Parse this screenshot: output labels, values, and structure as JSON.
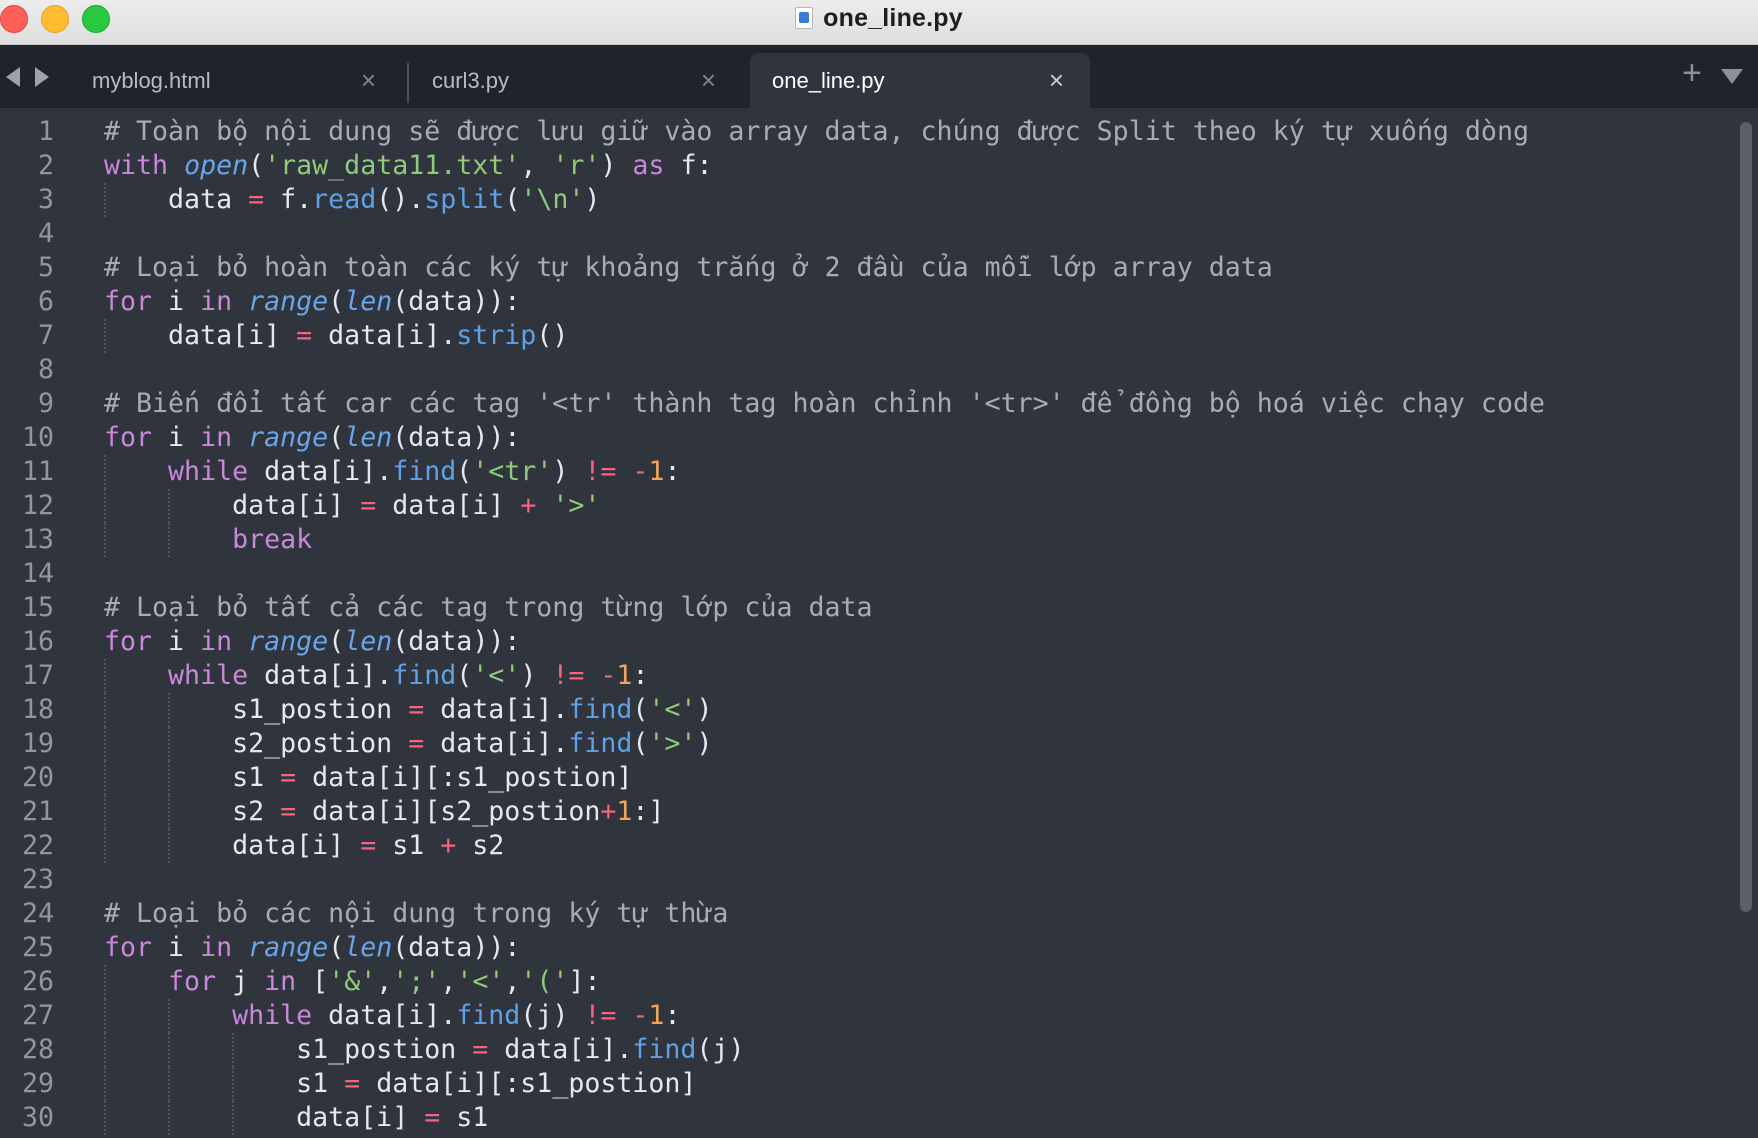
{
  "window": {
    "title": "one_line.py",
    "traffic_lights": [
      "close",
      "minimize",
      "maximize"
    ]
  },
  "tabs": [
    {
      "label": "myblog.html",
      "close": "×",
      "active": false
    },
    {
      "label": "curl3.py",
      "close": "×",
      "active": false
    },
    {
      "label": "one_line.py",
      "close": "×",
      "active": true
    }
  ],
  "tabbar": {
    "back_icon": "chevron-left-icon",
    "forward_icon": "chevron-right-icon",
    "new_tab": "+",
    "menu_icon": "chevron-down-icon"
  },
  "colors": {
    "background": "#2f343d",
    "comment": "#a7adb6",
    "keyword": "#c988d8",
    "builtin": "#6aa5e8",
    "string": "#8fca7d",
    "operator": "#f3667b",
    "number": "#f2a561"
  },
  "code_lines": [
    {
      "n": "1",
      "indent": 0,
      "tokens": [
        [
          "c",
          "# Toàn bộ nội dung sẽ được lưu giữ vào array data, chúng được Split theo ký tự xuống dòng"
        ]
      ]
    },
    {
      "n": "2",
      "indent": 0,
      "tokens": [
        [
          "k",
          "with "
        ],
        [
          "f",
          "open"
        ],
        [
          "p",
          "("
        ],
        [
          "s",
          "'raw_data11.txt'"
        ],
        [
          "p",
          ", "
        ],
        [
          "s",
          "'r'"
        ],
        [
          "p",
          ") "
        ],
        [
          "k",
          "as"
        ],
        [
          "p",
          " f:"
        ]
      ]
    },
    {
      "n": "3",
      "indent": 1,
      "tokens": [
        [
          "p",
          "    data "
        ],
        [
          "o",
          "="
        ],
        [
          "p",
          " f."
        ],
        [
          "m",
          "read"
        ],
        [
          "p",
          "()."
        ],
        [
          "m",
          "split"
        ],
        [
          "p",
          "("
        ],
        [
          "s",
          "'\\n'"
        ],
        [
          "p",
          ")"
        ]
      ]
    },
    {
      "n": "4",
      "indent": 0,
      "tokens": []
    },
    {
      "n": "5",
      "indent": 0,
      "tokens": [
        [
          "c",
          "# Loại bỏ hoàn toàn các ký tự khoảng trắng ở 2 đầu của mỗi lớp array data"
        ]
      ]
    },
    {
      "n": "6",
      "indent": 0,
      "tokens": [
        [
          "k",
          "for"
        ],
        [
          "p",
          " i "
        ],
        [
          "k",
          "in "
        ],
        [
          "f",
          "range"
        ],
        [
          "p",
          "("
        ],
        [
          "f",
          "len"
        ],
        [
          "p",
          "(data)):"
        ]
      ]
    },
    {
      "n": "7",
      "indent": 1,
      "tokens": [
        [
          "p",
          "    data[i] "
        ],
        [
          "o",
          "="
        ],
        [
          "p",
          " data[i]."
        ],
        [
          "m",
          "strip"
        ],
        [
          "p",
          "()"
        ]
      ]
    },
    {
      "n": "8",
      "indent": 0,
      "tokens": []
    },
    {
      "n": "9",
      "indent": 0,
      "tokens": [
        [
          "c",
          "# Biến đổi tất car các tag '<tr' thành tag hoàn chỉnh '<tr>' để đồng bộ hoá việc chạy code"
        ]
      ]
    },
    {
      "n": "10",
      "indent": 0,
      "tokens": [
        [
          "k",
          "for"
        ],
        [
          "p",
          " i "
        ],
        [
          "k",
          "in "
        ],
        [
          "f",
          "range"
        ],
        [
          "p",
          "("
        ],
        [
          "f",
          "len"
        ],
        [
          "p",
          "(data)):"
        ]
      ]
    },
    {
      "n": "11",
      "indent": 1,
      "tokens": [
        [
          "p",
          "    "
        ],
        [
          "k",
          "while"
        ],
        [
          "p",
          " data[i]."
        ],
        [
          "m",
          "find"
        ],
        [
          "p",
          "("
        ],
        [
          "s",
          "'<tr'"
        ],
        [
          "p",
          ") "
        ],
        [
          "o",
          "!="
        ],
        [
          "p",
          " "
        ],
        [
          "o",
          "-"
        ],
        [
          "n",
          "1"
        ],
        [
          "p",
          ":"
        ]
      ]
    },
    {
      "n": "12",
      "indent": 2,
      "tokens": [
        [
          "p",
          "        data[i] "
        ],
        [
          "o",
          "="
        ],
        [
          "p",
          " data[i] "
        ],
        [
          "o",
          "+"
        ],
        [
          "p",
          " "
        ],
        [
          "s",
          "'>'"
        ]
      ]
    },
    {
      "n": "13",
      "indent": 2,
      "tokens": [
        [
          "p",
          "        "
        ],
        [
          "k",
          "break"
        ]
      ]
    },
    {
      "n": "14",
      "indent": 0,
      "tokens": []
    },
    {
      "n": "15",
      "indent": 0,
      "tokens": [
        [
          "c",
          "# Loại bỏ tất cả các tag trong từng lớp của data"
        ]
      ]
    },
    {
      "n": "16",
      "indent": 0,
      "tokens": [
        [
          "k",
          "for"
        ],
        [
          "p",
          " i "
        ],
        [
          "k",
          "in "
        ],
        [
          "f",
          "range"
        ],
        [
          "p",
          "("
        ],
        [
          "f",
          "len"
        ],
        [
          "p",
          "(data)):"
        ]
      ]
    },
    {
      "n": "17",
      "indent": 1,
      "tokens": [
        [
          "p",
          "    "
        ],
        [
          "k",
          "while"
        ],
        [
          "p",
          " data[i]."
        ],
        [
          "m",
          "find"
        ],
        [
          "p",
          "("
        ],
        [
          "s",
          "'<'"
        ],
        [
          "p",
          ") "
        ],
        [
          "o",
          "!="
        ],
        [
          "p",
          " "
        ],
        [
          "o",
          "-"
        ],
        [
          "n",
          "1"
        ],
        [
          "p",
          ":"
        ]
      ]
    },
    {
      "n": "18",
      "indent": 2,
      "tokens": [
        [
          "p",
          "        s1_postion "
        ],
        [
          "o",
          "="
        ],
        [
          "p",
          " data[i]."
        ],
        [
          "m",
          "find"
        ],
        [
          "p",
          "("
        ],
        [
          "s",
          "'<'"
        ],
        [
          "p",
          ")"
        ]
      ]
    },
    {
      "n": "19",
      "indent": 2,
      "tokens": [
        [
          "p",
          "        s2_postion "
        ],
        [
          "o",
          "="
        ],
        [
          "p",
          " data[i]."
        ],
        [
          "m",
          "find"
        ],
        [
          "p",
          "("
        ],
        [
          "s",
          "'>'"
        ],
        [
          "p",
          ")"
        ]
      ]
    },
    {
      "n": "20",
      "indent": 2,
      "tokens": [
        [
          "p",
          "        s1 "
        ],
        [
          "o",
          "="
        ],
        [
          "p",
          " data[i][:s1_postion]"
        ]
      ]
    },
    {
      "n": "21",
      "indent": 2,
      "tokens": [
        [
          "p",
          "        s2 "
        ],
        [
          "o",
          "="
        ],
        [
          "p",
          " data[i][s2_postion"
        ],
        [
          "o",
          "+"
        ],
        [
          "n",
          "1"
        ],
        [
          "p",
          ":]"
        ]
      ]
    },
    {
      "n": "22",
      "indent": 2,
      "tokens": [
        [
          "p",
          "        data[i] "
        ],
        [
          "o",
          "="
        ],
        [
          "p",
          " s1 "
        ],
        [
          "o",
          "+"
        ],
        [
          "p",
          " s2"
        ]
      ]
    },
    {
      "n": "23",
      "indent": 0,
      "tokens": []
    },
    {
      "n": "24",
      "indent": 0,
      "tokens": [
        [
          "c",
          "# Loại bỏ các nội dung trong ký tự thừa"
        ]
      ]
    },
    {
      "n": "25",
      "indent": 0,
      "tokens": [
        [
          "k",
          "for"
        ],
        [
          "p",
          " i "
        ],
        [
          "k",
          "in "
        ],
        [
          "f",
          "range"
        ],
        [
          "p",
          "("
        ],
        [
          "f",
          "len"
        ],
        [
          "p",
          "(data)):"
        ]
      ]
    },
    {
      "n": "26",
      "indent": 1,
      "tokens": [
        [
          "p",
          "    "
        ],
        [
          "k",
          "for"
        ],
        [
          "p",
          " j "
        ],
        [
          "k",
          "in"
        ],
        [
          "p",
          " ["
        ],
        [
          "s",
          "'&'"
        ],
        [
          "p",
          ","
        ],
        [
          "s",
          "';'"
        ],
        [
          "p",
          ","
        ],
        [
          "s",
          "'<'"
        ],
        [
          "p",
          ","
        ],
        [
          "s",
          "'('"
        ],
        [
          "p",
          "]:"
        ]
      ]
    },
    {
      "n": "27",
      "indent": 2,
      "tokens": [
        [
          "p",
          "        "
        ],
        [
          "k",
          "while"
        ],
        [
          "p",
          " data[i]."
        ],
        [
          "m",
          "find"
        ],
        [
          "p",
          "(j) "
        ],
        [
          "o",
          "!="
        ],
        [
          "p",
          " "
        ],
        [
          "o",
          "-"
        ],
        [
          "n",
          "1"
        ],
        [
          "p",
          ":"
        ]
      ]
    },
    {
      "n": "28",
      "indent": 3,
      "tokens": [
        [
          "p",
          "            s1_postion "
        ],
        [
          "o",
          "="
        ],
        [
          "p",
          " data[i]."
        ],
        [
          "m",
          "find"
        ],
        [
          "p",
          "(j)"
        ]
      ]
    },
    {
      "n": "29",
      "indent": 3,
      "tokens": [
        [
          "p",
          "            s1 "
        ],
        [
          "o",
          "="
        ],
        [
          "p",
          " data[i][:s1_postion]"
        ]
      ]
    },
    {
      "n": "30",
      "indent": 3,
      "tokens": [
        [
          "p",
          "            data[i] "
        ],
        [
          "o",
          "="
        ],
        [
          "p",
          " s1"
        ]
      ]
    }
  ]
}
